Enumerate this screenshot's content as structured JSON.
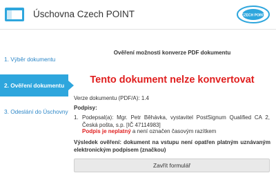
{
  "header": {
    "title": "Úschovna Czech POINT",
    "app_icon": "window-icon",
    "logo": {
      "icon": "czech-point-logo",
      "text": "CZECH POINT",
      "color": "#2ea6dd"
    }
  },
  "sidebar": {
    "items": [
      {
        "label": "1. Výběr dokumentu",
        "active": false
      },
      {
        "label": "2. Ověření dokumentu",
        "active": true
      },
      {
        "label": "3. Odeslání do Úschovny",
        "active": false
      }
    ]
  },
  "main": {
    "subtitle": "Ověření možnosti konverze PDF dokumentu",
    "error_title": "Tento dokument nelze konvertovat",
    "version": "Verze dokumentu (PDF/A): 1.4",
    "signatures_heading": "Podpisy:",
    "signatures": [
      {
        "number": "1.",
        "text": "Podepsal(a): Mgr. Petr Běhávka, vystavitel PostSignum Qualified CA 2, Česká pošta, s.p. [IČ 47114983]",
        "status_invalid": "Podpis je neplatný",
        "status_rest": " a není označen časovým razítkem"
      }
    ],
    "result": "Výsledek ověření:  dokument na vstupu není opatřen platným uznávaným elektronickým podpisem (značkou)"
  },
  "buttons": {
    "close_label": "Zavřít formulář"
  },
  "colors": {
    "accent": "#2ea6dd",
    "error": "#e01e1e",
    "link": "#2d87c8"
  }
}
